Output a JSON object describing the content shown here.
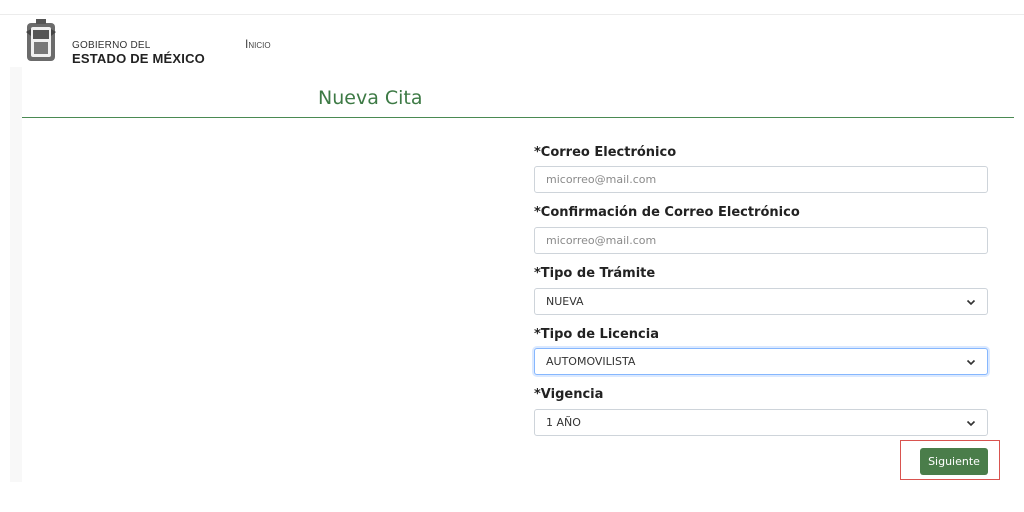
{
  "header": {
    "brand_line1": "GOBIERNO DEL",
    "brand_line2": "ESTADO DE MÉXICO",
    "nav_inicio": "Inicio"
  },
  "page": {
    "title": "Nueva Cita"
  },
  "form": {
    "email": {
      "label": "*Correo Electrónico",
      "placeholder": "micorreo@mail.com",
      "value": ""
    },
    "email_confirm": {
      "label": "*Confirmación de Correo Electrónico",
      "placeholder": "micorreo@mail.com",
      "value": ""
    },
    "tramite": {
      "label": "*Tipo de Trámite",
      "selected": "NUEVA"
    },
    "licencia": {
      "label": "*Tipo de Licencia",
      "selected": "AUTOMOVILISTA"
    },
    "vigencia": {
      "label": "*Vigencia",
      "selected": "1 AÑO"
    },
    "submit_label": "Siguiente"
  },
  "colors": {
    "accent": "#3d7a45",
    "button": "#4a7d4a",
    "highlight": "#d9534f"
  },
  "icons": {
    "logo": "state-emblem-icon",
    "select_arrow": "chevron-down-icon"
  }
}
